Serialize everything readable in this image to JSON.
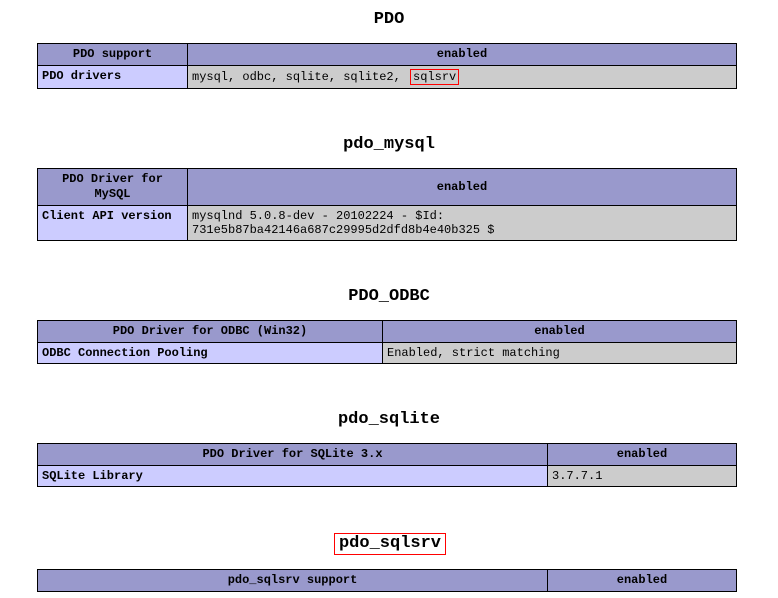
{
  "pdo": {
    "title": "PDO",
    "header": {
      "col1": "PDO support",
      "col2": "enabled"
    },
    "row": {
      "label": "PDO drivers",
      "value_prefix": "mysql, odbc, sqlite, sqlite2, ",
      "value_highlight": "sqlsrv"
    }
  },
  "pdo_mysql": {
    "title": "pdo_mysql",
    "header": {
      "col1": "PDO Driver for MySQL",
      "col2": "enabled"
    },
    "row": {
      "label": "Client API version",
      "value": "mysqlnd 5.0.8-dev - 20102224 - $Id: 731e5b87ba42146a687c29995d2dfd8b4e40b325 $"
    }
  },
  "pdo_odbc": {
    "title": "PDO_ODBC",
    "header": {
      "col1": "PDO Driver for ODBC (Win32)",
      "col2": "enabled"
    },
    "row": {
      "label": "ODBC Connection Pooling",
      "value": "Enabled, strict matching"
    }
  },
  "pdo_sqlite": {
    "title": "pdo_sqlite",
    "header": {
      "col1": "PDO Driver for SQLite 3.x",
      "col2": "enabled"
    },
    "row": {
      "label": "SQLite Library",
      "value": "3.7.7.1"
    }
  },
  "pdo_sqlsrv": {
    "title": "pdo_sqlsrv",
    "header": {
      "col1": "pdo_sqlsrv support",
      "col2": "enabled"
    }
  }
}
